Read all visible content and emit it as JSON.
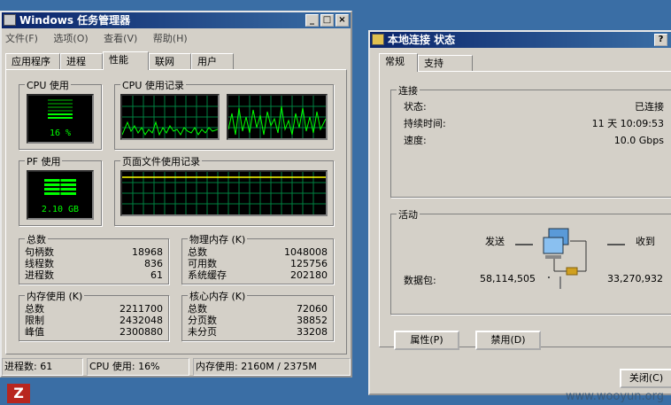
{
  "taskmgr": {
    "title": "Windows 任务管理器",
    "menu": [
      "文件(F)",
      "选项(O)",
      "查看(V)",
      "帮助(H)"
    ],
    "tabs": [
      "应用程序",
      "进程",
      "性能",
      "联网",
      "用户"
    ],
    "active_tab": "性能",
    "cpu_usage": {
      "label": "CPU 使用",
      "value": "16 %"
    },
    "cpu_history": {
      "label": "CPU 使用记录"
    },
    "pf_usage": {
      "label": "PF 使用",
      "value": "2.10 GB"
    },
    "pf_history": {
      "label": "页面文件使用记录"
    },
    "totals": {
      "label": "总数",
      "rows": [
        {
          "k": "句柄数",
          "v": "18968"
        },
        {
          "k": "线程数",
          "v": "836"
        },
        {
          "k": "进程数",
          "v": "61"
        }
      ]
    },
    "physical": {
      "label": "物理内存 (K)",
      "rows": [
        {
          "k": "总数",
          "v": "1048008"
        },
        {
          "k": "可用数",
          "v": "125756"
        },
        {
          "k": "系统缓存",
          "v": "202180"
        }
      ]
    },
    "commit": {
      "label": "内存使用 (K)",
      "rows": [
        {
          "k": "总数",
          "v": "2211700"
        },
        {
          "k": "限制",
          "v": "2432048"
        },
        {
          "k": "峰值",
          "v": "2300880"
        }
      ]
    },
    "kernel": {
      "label": "核心内存 (K)",
      "rows": [
        {
          "k": "总数",
          "v": "72060"
        },
        {
          "k": "分页数",
          "v": "38852"
        },
        {
          "k": "未分页",
          "v": "33208"
        }
      ]
    },
    "status": {
      "processes": "进程数: 61",
      "cpu": "CPU 使用: 16%",
      "memory": "内存使用: 2160M / 2375M"
    }
  },
  "lanstatus": {
    "title": "本地连接 状态",
    "tabs": [
      "常规",
      "支持"
    ],
    "connection": {
      "label": "连接",
      "rows": [
        {
          "k": "状态:",
          "v": "已连接"
        },
        {
          "k": "持续时间:",
          "v": "11 天 10:09:53"
        },
        {
          "k": "速度:",
          "v": "10.0 Gbps"
        }
      ]
    },
    "activity": {
      "label": "活动",
      "sent_label": "发送",
      "received_label": "收到",
      "packets_label": "数据包:",
      "sent_value": "58,114,505",
      "received_value": "33,270,932"
    },
    "buttons": {
      "properties": "属性(P)",
      "disable": "禁用(D)",
      "close": "关闭(C)"
    }
  },
  "watermark": "www.wooyun.org",
  "icons": {
    "taskmgr": "taskmgr-window-icon",
    "network": "network-computers-icon",
    "filezilla": "filezilla-icon"
  },
  "colors": {
    "graph_line": "#00ff00",
    "grid": "#008040",
    "titlebar": "#0a246a"
  }
}
